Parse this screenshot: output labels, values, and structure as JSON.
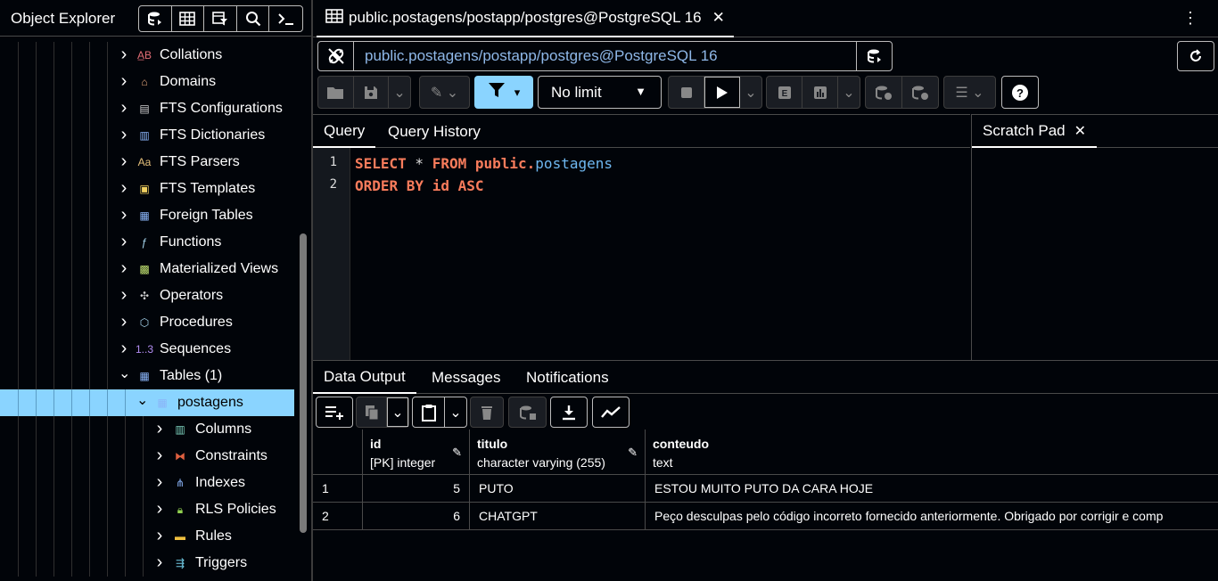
{
  "object_explorer": {
    "title": "Object Explorer",
    "tree": [
      {
        "label": "Collations",
        "icon": "collation-icon",
        "expanded": false,
        "depth": 0
      },
      {
        "label": "Domains",
        "icon": "domain-icon",
        "expanded": false,
        "depth": 0
      },
      {
        "label": "FTS Configurations",
        "icon": "fts-configuration-icon",
        "expanded": false,
        "depth": 0
      },
      {
        "label": "FTS Dictionaries",
        "icon": "fts-dictionary-icon",
        "expanded": false,
        "depth": 0
      },
      {
        "label": "FTS Parsers",
        "icon": "fts-parser-icon",
        "expanded": false,
        "depth": 0
      },
      {
        "label": "FTS Templates",
        "icon": "fts-template-icon",
        "expanded": false,
        "depth": 0
      },
      {
        "label": "Foreign Tables",
        "icon": "foreign-table-icon",
        "expanded": false,
        "depth": 0
      },
      {
        "label": "Functions",
        "icon": "function-icon",
        "expanded": false,
        "depth": 0
      },
      {
        "label": "Materialized Views",
        "icon": "materialized-view-icon",
        "expanded": false,
        "depth": 0
      },
      {
        "label": "Operators",
        "icon": "operator-icon",
        "expanded": false,
        "depth": 0
      },
      {
        "label": "Procedures",
        "icon": "procedure-icon",
        "expanded": false,
        "depth": 0
      },
      {
        "label": "Sequences",
        "icon": "sequence-icon",
        "expanded": false,
        "depth": 0
      },
      {
        "label": "Tables (1)",
        "icon": "tables-icon",
        "expanded": true,
        "depth": 0
      },
      {
        "label": "postagens",
        "icon": "table-icon",
        "expanded": true,
        "depth": 1,
        "selected": true
      },
      {
        "label": "Columns",
        "icon": "columns-icon",
        "expanded": false,
        "depth": 2
      },
      {
        "label": "Constraints",
        "icon": "constraints-icon",
        "expanded": false,
        "depth": 2
      },
      {
        "label": "Indexes",
        "icon": "indexes-icon",
        "expanded": false,
        "depth": 2
      },
      {
        "label": "RLS Policies",
        "icon": "rls-policy-icon",
        "expanded": false,
        "depth": 2
      },
      {
        "label": "Rules",
        "icon": "rules-icon",
        "expanded": false,
        "depth": 2
      },
      {
        "label": "Triggers",
        "icon": "triggers-icon",
        "expanded": false,
        "depth": 2
      }
    ]
  },
  "query_tab": {
    "title": "public.postagens/postapp/postgres@PostgreSQL 16"
  },
  "connection": {
    "text": "public.postagens/postapp/postgres@PostgreSQL 16"
  },
  "toolbar": {
    "limit_label": "No limit"
  },
  "editor_tabs": {
    "query": "Query",
    "history": "Query History",
    "scratch": "Scratch Pad"
  },
  "editor": {
    "line_numbers": [
      "1",
      "2"
    ],
    "line1": {
      "kw1": "SELECT",
      "star": " * ",
      "kw2": "FROM",
      "schema": " public.",
      "table": "postagens"
    },
    "line2": {
      "kw": "ORDER BY id ASC"
    }
  },
  "results_tabs": {
    "data_output": "Data Output",
    "messages": "Messages",
    "notifications": "Notifications"
  },
  "grid": {
    "columns": [
      {
        "name": "id",
        "type": "[PK] integer"
      },
      {
        "name": "titulo",
        "type": "character varying (255)"
      },
      {
        "name": "conteudo",
        "type": "text"
      }
    ],
    "rows": [
      {
        "row_num": "1",
        "id": "5",
        "titulo": "PUTO",
        "conteudo": "ESTOU MUITO PUTO DA CARA HOJE"
      },
      {
        "row_num": "2",
        "id": "6",
        "titulo": "CHATGPT",
        "conteudo": "Peço desculpas pelo código incorreto fornecido anteriormente. Obrigado por corrigir e comp"
      }
    ]
  },
  "colors": {
    "background": "#010409",
    "selection": "#8ad4ff",
    "keyword": "#f97c5c",
    "identifier": "#6fb8f0",
    "connection_text": "#8fb8e8"
  }
}
